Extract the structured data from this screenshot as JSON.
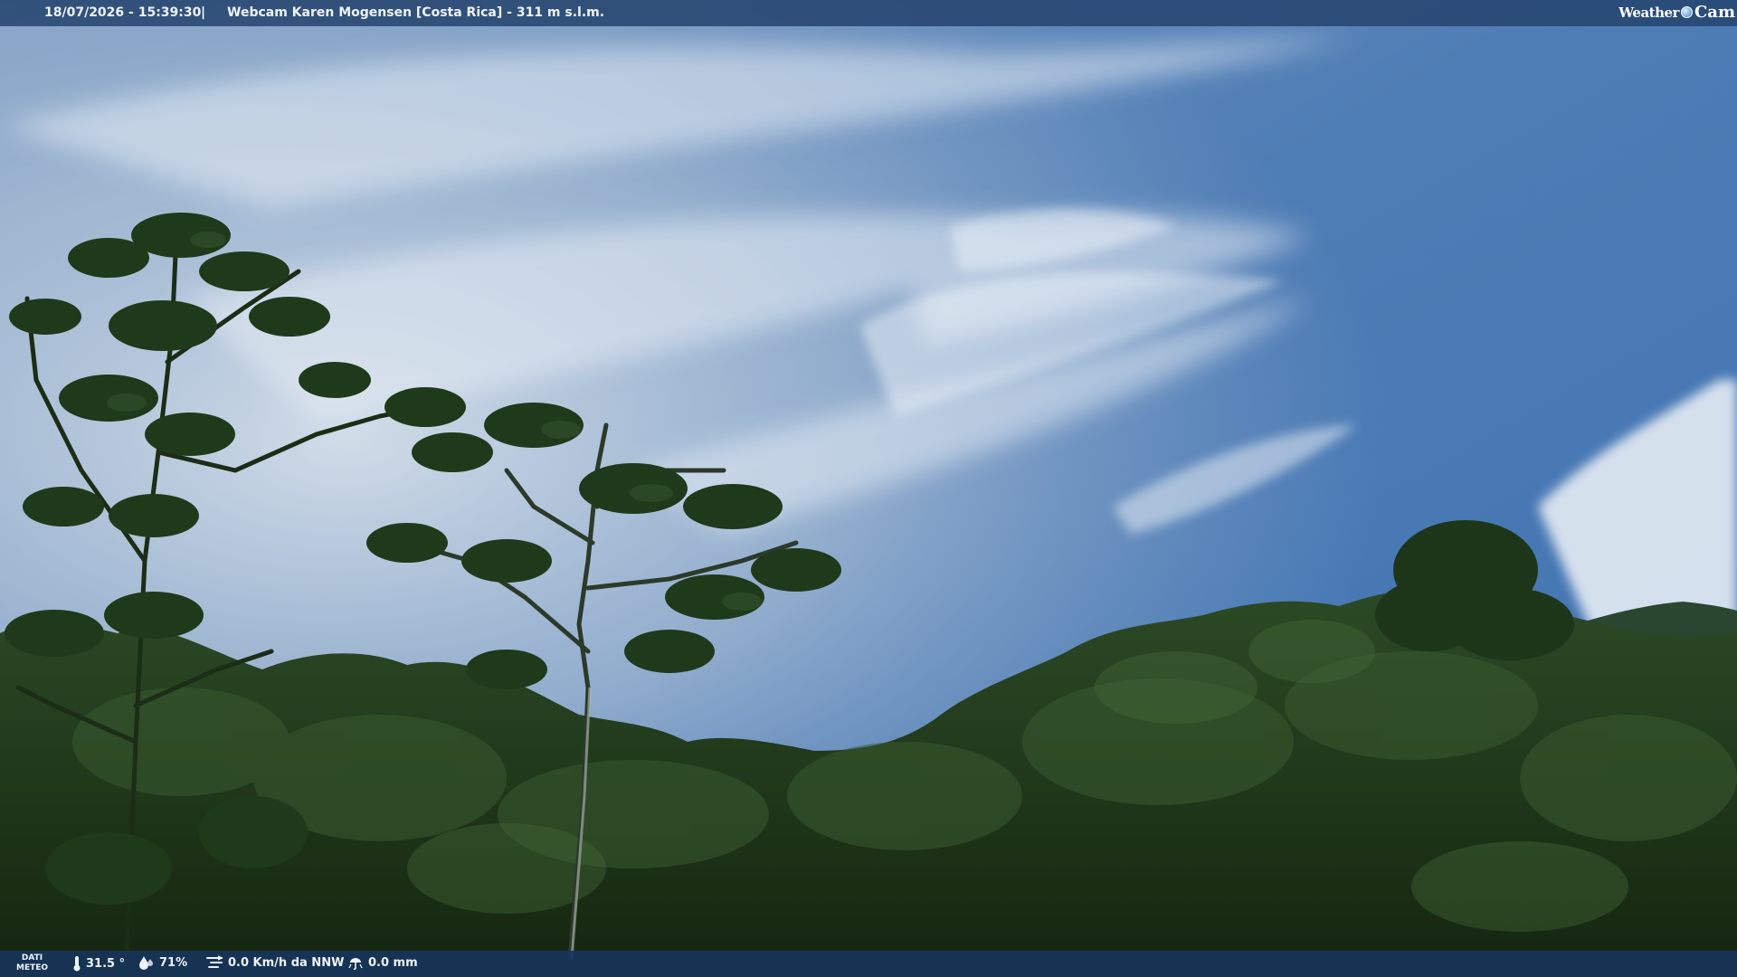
{
  "header": {
    "datetime": "18/07/2026 - 15:39:30",
    "separator": "|",
    "title": "Webcam Karen Mogensen [Costa Rica]  - 311 m s.l.m.",
    "logo_weather": "Weather",
    "logo_cam": "Cam"
  },
  "footer": {
    "dati_line1": "DATI",
    "dati_line2": "METEO",
    "temperature": "31.5 °",
    "humidity": "71%",
    "wind": "0.0 Km/h da NNW",
    "rain": "0.0 mm"
  },
  "icons": {
    "temperature": "thermometer-icon",
    "humidity": "humidity-drop-icon",
    "wind": "wind-icon",
    "rain": "rain-icon"
  },
  "colors": {
    "sky_top": "#4a75ad",
    "sky_haze": "#c9d6e4",
    "canopy": "#1f3a1c",
    "bar": "#264670"
  }
}
